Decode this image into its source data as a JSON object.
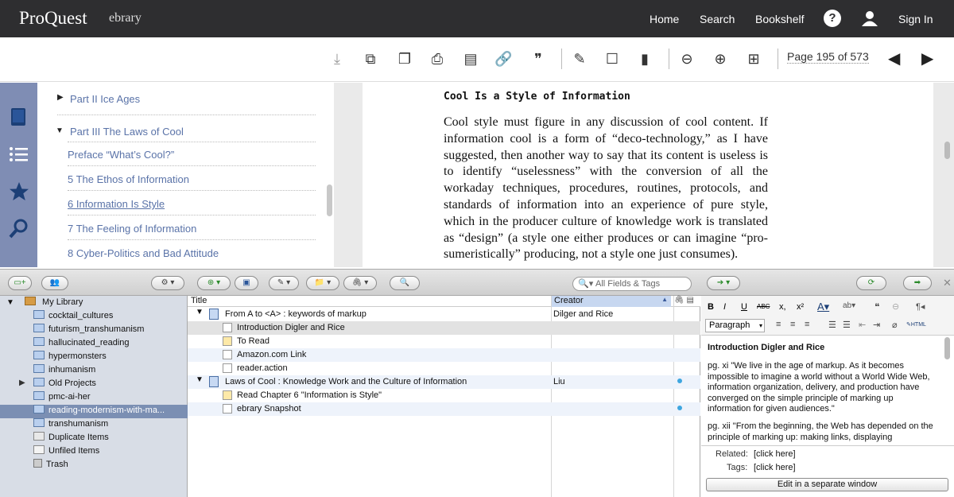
{
  "header": {
    "logo": "ProQuest",
    "logo_sub": "ebrary",
    "nav": [
      "Home",
      "Search",
      "Bookshelf"
    ],
    "help": "?",
    "sign_in": "Sign In"
  },
  "toolbar": {
    "page_indicator": "Page 195 of 573"
  },
  "toc": {
    "part2": "Part II Ice Ages",
    "part3": "Part III The Laws of Cool",
    "items": [
      "Preface “What’s Cool?”",
      "5 The Ethos of Information",
      "6 Information Is Style",
      "7 The Feeling of Information",
      "8 Cyber-Politics and Bad Attitude"
    ]
  },
  "page": {
    "heading": "Cool Is a Style of Information",
    "body": "Cool style must figure in any discussion of cool content. If information cool is a form of “deco-technology,” as I have suggested, then another way to say that its content is useless is to identify “uselessness” with the conversion of all the workaday techniques, procedures, routines, protocols, and standards of information into an experience of pure style, which in the producer culture of knowledge work is translated as “design” (a style one either produces or can imagine “pro-sumeristically” producing, not a style one just consumes)."
  },
  "zotero": {
    "search_placeholder": "All Fields & Tags",
    "library": {
      "root": "My Library",
      "collections": [
        "cocktail_cultures",
        "futurism_transhumanism",
        "hallucinated_reading",
        "hypermonsters",
        "inhumanism",
        "Old Projects",
        "pmc-ai-her",
        "reading-modernism-with-ma...",
        "transhumanism",
        "Duplicate Items",
        "Unfiled Items",
        "Trash"
      ]
    },
    "columns": {
      "title": "Title",
      "creator": "Creator"
    },
    "items": [
      {
        "title": "From A to <A> : keywords of markup",
        "creator": "Dilger and Rice"
      },
      {
        "title": "Introduction Digler and Rice",
        "creator": ""
      },
      {
        "title": "To Read",
        "creator": ""
      },
      {
        "title": "Amazon.com Link",
        "creator": ""
      },
      {
        "title": "reader.action",
        "creator": ""
      },
      {
        "title": "Laws of Cool : Knowledge Work and the Culture of Information",
        "creator": "Liu"
      },
      {
        "title": "Read Chapter 6 \"Information is Style\"",
        "creator": ""
      },
      {
        "title": "ebrary Snapshot",
        "creator": ""
      }
    ],
    "note": {
      "format_select": "Paragraph",
      "title_line": "Introduction Digler and Rice",
      "para1": "pg. xi \"We live in the age of markup. As it becomes impossible to imagine a world without a World Wide Web, information organization, delivery, and production have converged on the simple principle of marking up information for given audiences.\"",
      "para2": "pg. xii \"From the beginning, the Web has depended on the principle of marking up: making links, displaying",
      "related_label": "Related:",
      "related_value": "[click here]",
      "tags_label": "Tags:",
      "tags_value": "[click here]",
      "edit_button": "Edit in a separate window"
    }
  }
}
